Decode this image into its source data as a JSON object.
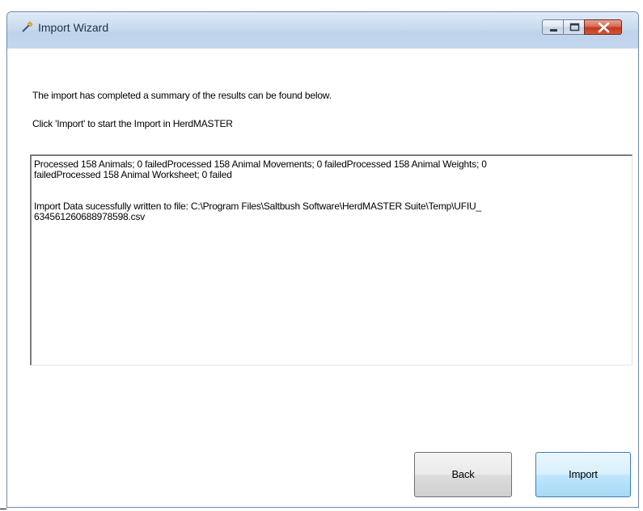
{
  "window": {
    "title": "Import Wizard",
    "icon": "wand-icon"
  },
  "titlebar_buttons": {
    "minimize": "minimize-icon",
    "maximize": "maximize-icon",
    "close": "close-icon"
  },
  "messages": {
    "line1": "The import has completed a summary of the results can be found below.",
    "line2": "Click 'Import' to start the Import in HerdMASTER"
  },
  "results": {
    "summary_line1": "Processed 158 Animals; 0 failedProcessed 158 Animal Movements; 0 failedProcessed 158 Animal Weights; 0",
    "summary_line2": "failedProcessed 158 Animal Worksheet; 0 failed",
    "file_line1": "Import Data sucessfully written to file: C:\\Program Files\\Saltbush Software\\HerdMASTER Suite\\Temp\\UFIU_",
    "file_line2": "634561260688978598.csv"
  },
  "buttons": {
    "back": "Back",
    "import": "Import"
  },
  "colors": {
    "close_button": "#c2391f",
    "import_button_border": "#3c7fb1"
  }
}
